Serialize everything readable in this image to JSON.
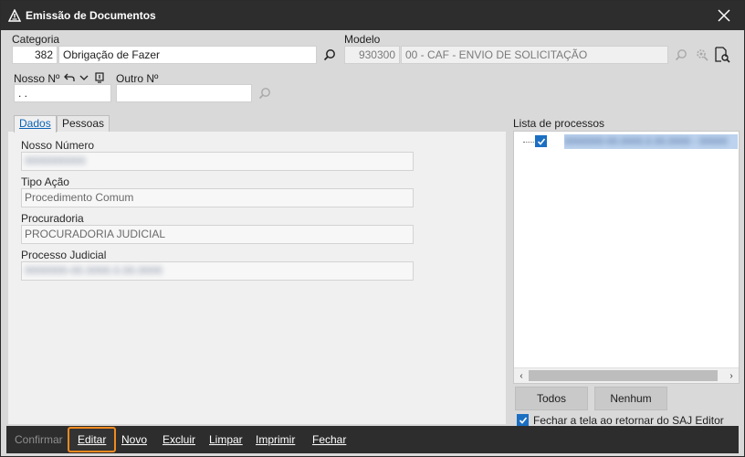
{
  "window": {
    "title": "Emissão de Documentos"
  },
  "header": {
    "categoria_label": "Categoria",
    "categoria_code": "382",
    "categoria_name": "Obrigação de Fazer",
    "modelo_label": "Modelo",
    "modelo_code": "930300",
    "modelo_name": "00 - CAF - ENVIO DE SOLICITAÇÃO",
    "nosso_label": "Nosso Nº",
    "nosso_value": " . .",
    "outro_label": "Outro Nº",
    "outro_value": ""
  },
  "tabs": [
    {
      "label": "Dados",
      "active": true
    },
    {
      "label": "Pessoas",
      "active": false
    }
  ],
  "dados": {
    "nosso_numero_label": "Nosso Número",
    "nosso_numero_value": "0000000000",
    "tipo_acao_label": "Tipo Ação",
    "tipo_acao_value": "Procedimento Comum",
    "procuradoria_label": "Procuradoria",
    "procuradoria_value": "PROCURADORIA JUDICIAL",
    "processo_label": "Processo Judicial",
    "processo_value": "0000000-00.0000.0.00.0000"
  },
  "processos": {
    "label": "Lista de processos",
    "items": [
      {
        "text": "0000000-00.0000.0.00.0000 - 00000",
        "checked": true
      }
    ]
  },
  "buttons": {
    "todos": "Todos",
    "nenhum": "Nenhum"
  },
  "fechar_checkbox": {
    "label": "Fechar a tela ao retornar do SAJ Editor",
    "checked": true
  },
  "bottombar": {
    "confirmar": "Confirmar",
    "editar": "Editar",
    "novo": "Novo",
    "excluir": "Excluir",
    "limpar": "Limpar",
    "imprimir": "Imprimir",
    "fechar": "Fechar"
  },
  "colors": {
    "accent": "#1b6fc2",
    "highlight": "#ef8a1f",
    "titlebar": "#2d2d2d"
  },
  "icons": {
    "app": "warning-triangle-icon",
    "close": "close-icon",
    "search": "search-icon",
    "undo": "undo-arrow-icon",
    "dropdown": "chevron-down-icon",
    "bracket": "bracket-icon",
    "settings": "gear-search-icon",
    "document": "document-search-icon"
  }
}
